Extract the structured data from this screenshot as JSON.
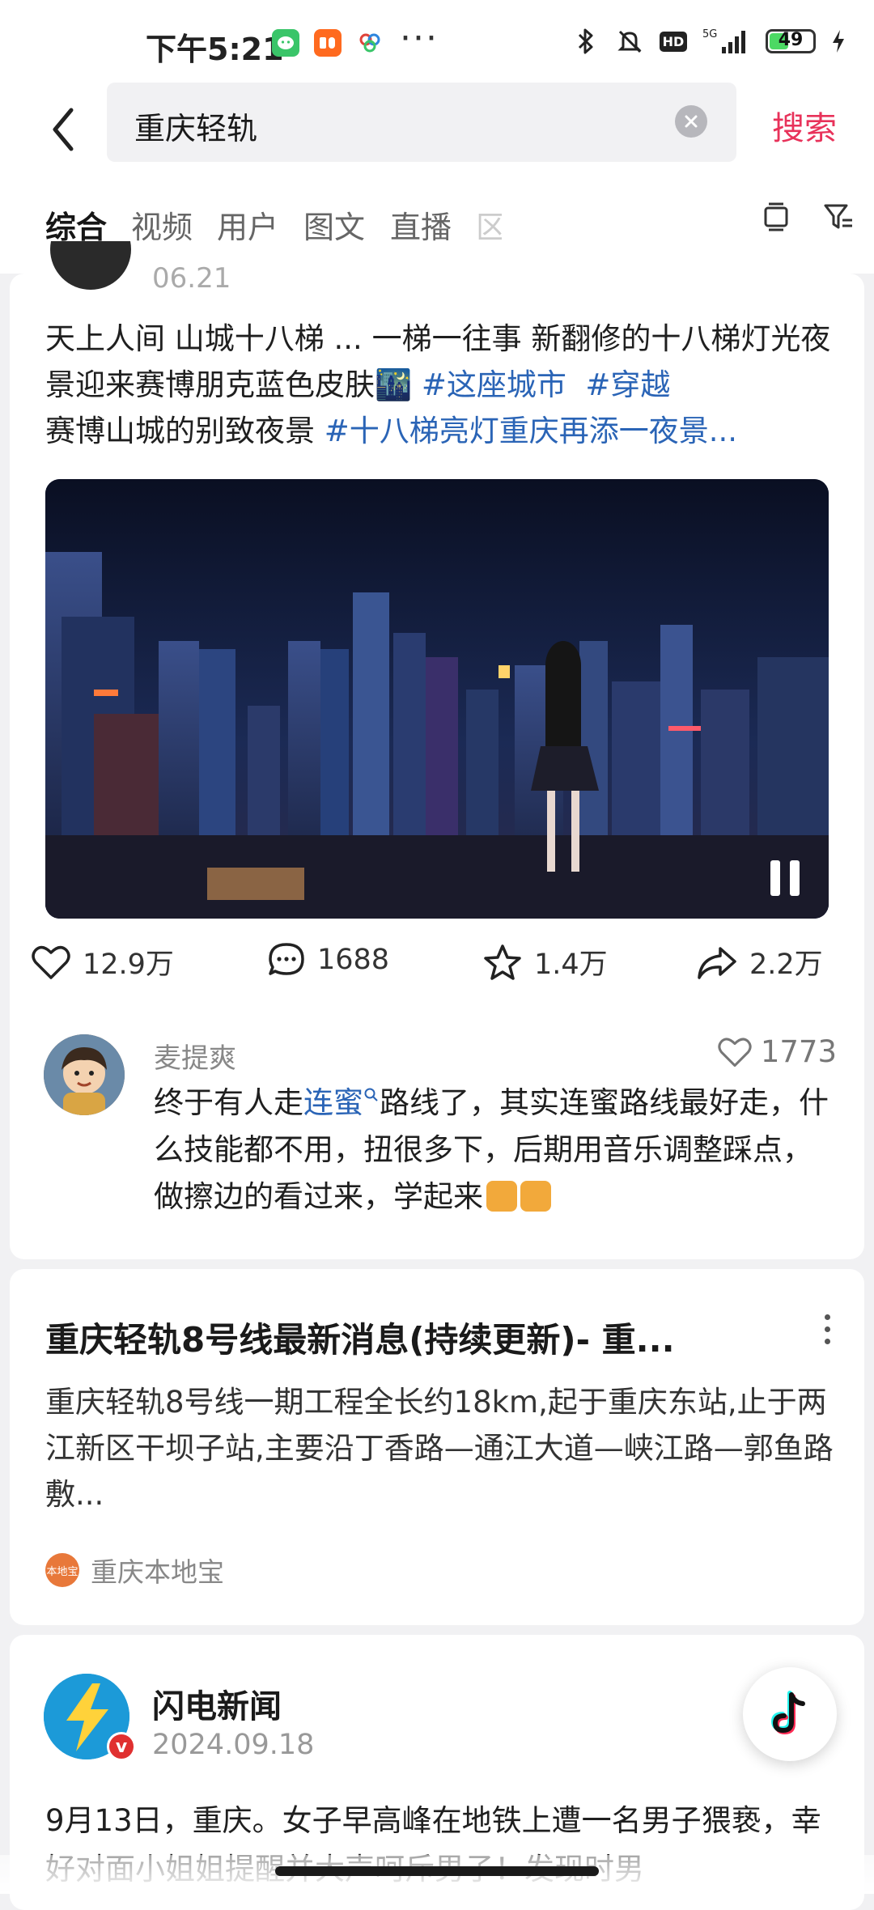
{
  "status_bar": {
    "time": "下午5:21",
    "app_icons": [
      "wechat-icon",
      "58-icon",
      "cloud-icon"
    ],
    "more": "···",
    "right_icons": [
      "bluetooth-icon",
      "mute-icon",
      "hd-icon",
      "5g-signal-icon"
    ],
    "network": "5G",
    "hd": "HD",
    "battery": "49",
    "battery_level_percent": 49
  },
  "search": {
    "query": "重庆轻轨",
    "submit_label": "搜索"
  },
  "tabs": [
    {
      "label": "综合",
      "active": true
    },
    {
      "label": "视频"
    },
    {
      "label": "用户"
    },
    {
      "label": "图文"
    },
    {
      "label": "直播"
    },
    {
      "label": "区"
    }
  ],
  "post": {
    "date": "06.21",
    "text_plain_1": "天上人间 山城十八梯 ... 一梯一往事 新翻修的十八梯灯光夜景迎来赛博朋克蓝色皮肤🌃 ",
    "tag_1": "#这座城市",
    "tag_2": "#穿越",
    "text_plain_2": "赛博山城的别致夜景 ",
    "tag_3": "#十八梯亮灯重庆再添一夜景...",
    "stats": {
      "likes": "12.9万",
      "comments": "1688",
      "favorites": "1.4万",
      "shares": "2.2万"
    },
    "top_comment": {
      "user": "麦提爽",
      "likes": "1773",
      "text_1": "终于有人走",
      "link": "连蜜",
      "text_2": "路线了，其实连蜜路线最好走，什么技能都不用，扭很多下，后期用音乐调整踩点，做擦边的看过来，学起来"
    }
  },
  "article": {
    "title": "重庆轻轨8号线最新消息(持续更新)- 重...",
    "body": "重庆轻轨8号线一期工程全长约18km,起于重庆东站,止于两江新区干坝子站,主要沿丁香路—通江大道—峡江路—郭鱼路敷...",
    "source": "重庆本地宝",
    "source_logo_text": "本地宝"
  },
  "news": {
    "name": "闪电新闻",
    "date": "2024.09.18",
    "verified": "v",
    "body": "9月13日，重庆。女子早高峰在地铁上遭一名男子猥亵，幸好对面小姐姐提醒并大声呵斥男子！发现时男"
  },
  "colors": {
    "accent": "#e8325a",
    "hashtag": "#2a64b6",
    "background": "#f1f1f3"
  }
}
